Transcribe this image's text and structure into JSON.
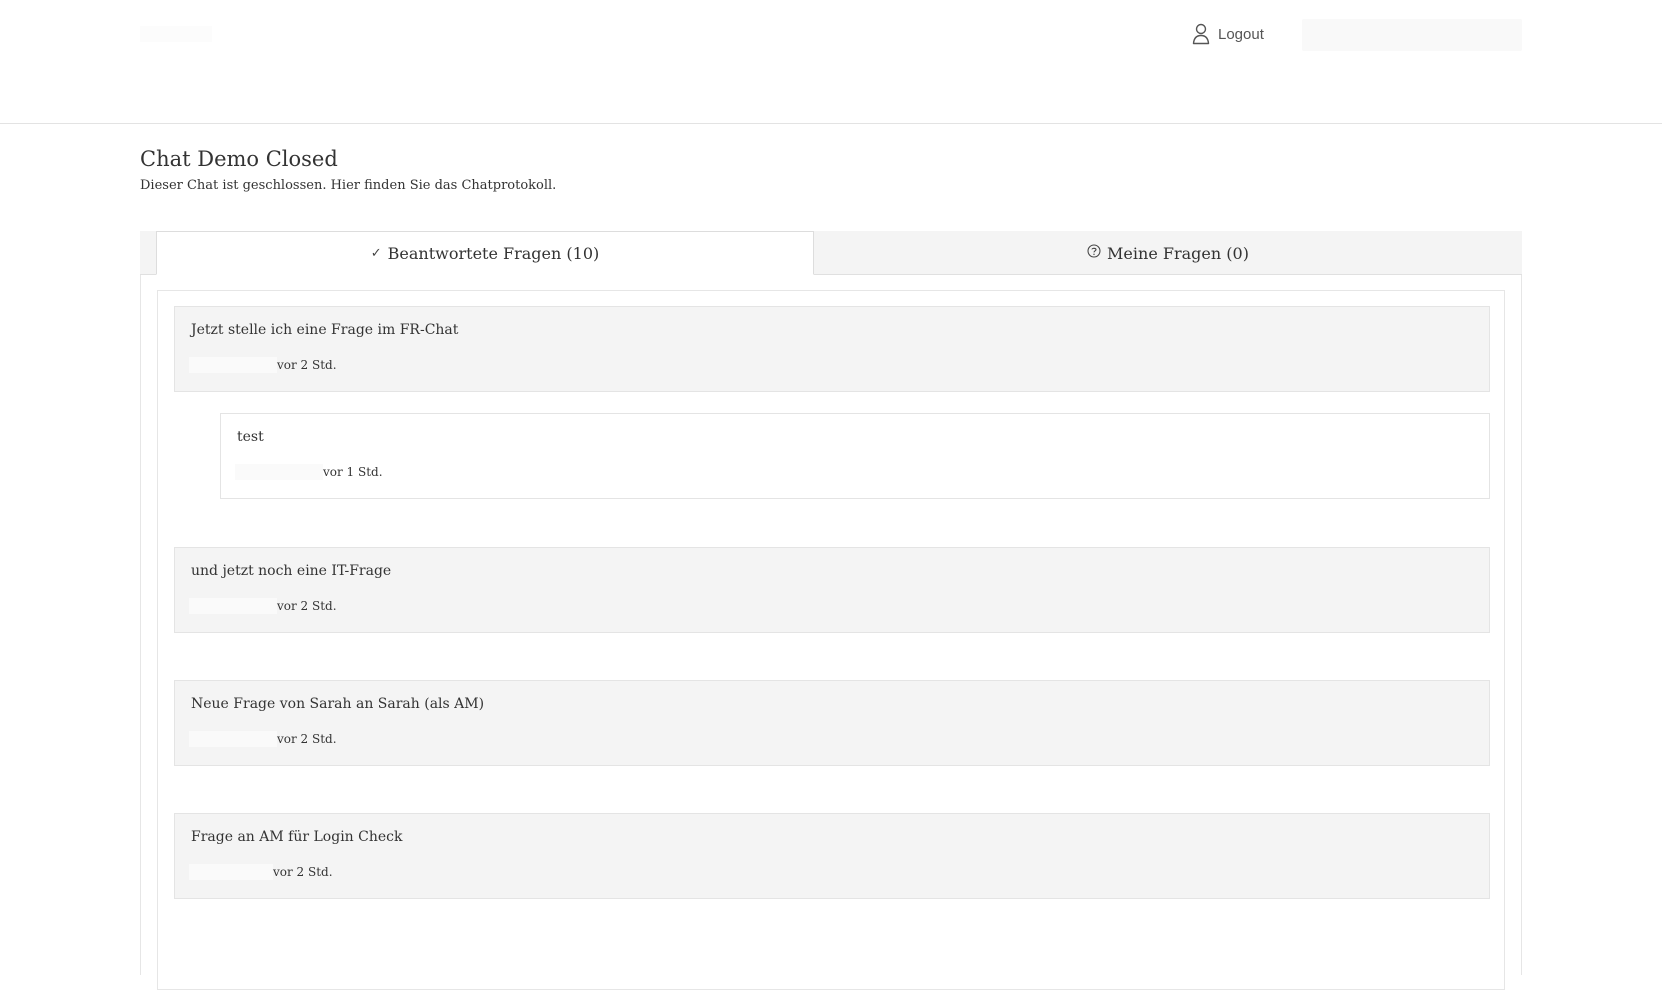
{
  "header": {
    "logout_label": "Logout",
    "logout_icon": "user-icon"
  },
  "page": {
    "title": "Chat Demo Closed",
    "subtitle": "Dieser Chat ist geschlossen. Hier finden Sie das Chatprotokoll."
  },
  "tabs": [
    {
      "icon": "✓",
      "label": "Beantwortete Fragen (10)",
      "active": true
    },
    {
      "icon": "⍰",
      "label": "Meine Fragen (0)",
      "active": false
    }
  ],
  "entries": [
    {
      "kind": "question",
      "text": "Jetzt stelle ich eine Frage im FR-Chat",
      "time": "vor 2 Std."
    },
    {
      "kind": "answer",
      "text": "test",
      "time": "vor 1 Std."
    },
    {
      "kind": "question",
      "text": "und jetzt noch eine IT-Frage",
      "time": "vor 2 Std."
    },
    {
      "kind": "question",
      "text": "Neue Frage von Sarah an Sarah (als AM)",
      "time": "vor 2 Std."
    },
    {
      "kind": "question",
      "text": "Frage an AM für Login Check",
      "time": "vor 2 Std."
    }
  ],
  "colors": {
    "panel_background": "#f4f4f4",
    "border": "#e4e4e4",
    "text": "#333333"
  }
}
